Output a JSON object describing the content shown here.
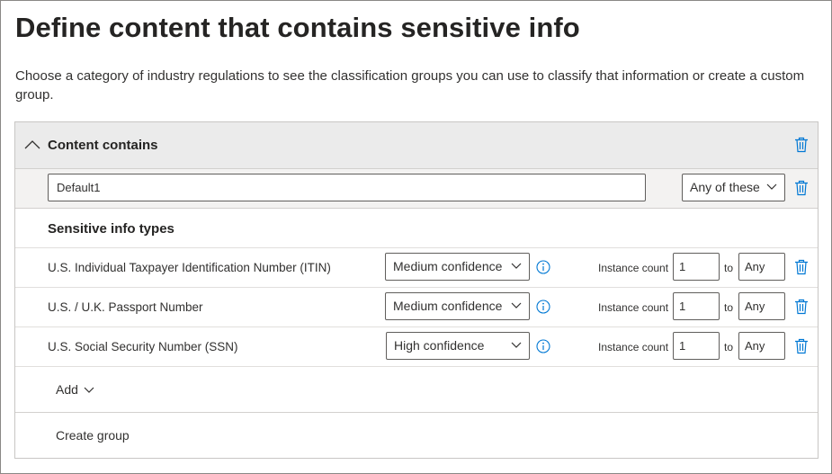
{
  "page": {
    "title": "Define content that contains sensitive info",
    "description": "Choose a category of industry regulations to see the classification groups you can use to classify that information or create a custom group."
  },
  "group": {
    "header_label": "Content contains",
    "name_value": "Default1",
    "match_mode": "Any of these",
    "section_label": "Sensitive info types",
    "instance_count_label": "Instance count",
    "to_label": "to",
    "types": [
      {
        "name": "U.S. Individual Taxpayer Identification Number (ITIN)",
        "confidence": "Medium confidence",
        "min": "1",
        "max": "Any"
      },
      {
        "name": "U.S. / U.K. Passport Number",
        "confidence": "Medium confidence",
        "min": "1",
        "max": "Any"
      },
      {
        "name": "U.S. Social Security Number (SSN)",
        "confidence": "High confidence",
        "min": "1",
        "max": "Any"
      }
    ],
    "add_label": "Add",
    "create_group_label": "Create group"
  },
  "icons": {
    "collapse": "chevron-up-icon",
    "delete": "trash-icon",
    "dropdown": "chevron-down-icon",
    "info": "info-icon"
  },
  "colors": {
    "accent": "#0078d4",
    "header_bg": "#ebebeb",
    "row_bg": "#f3f2f1"
  }
}
